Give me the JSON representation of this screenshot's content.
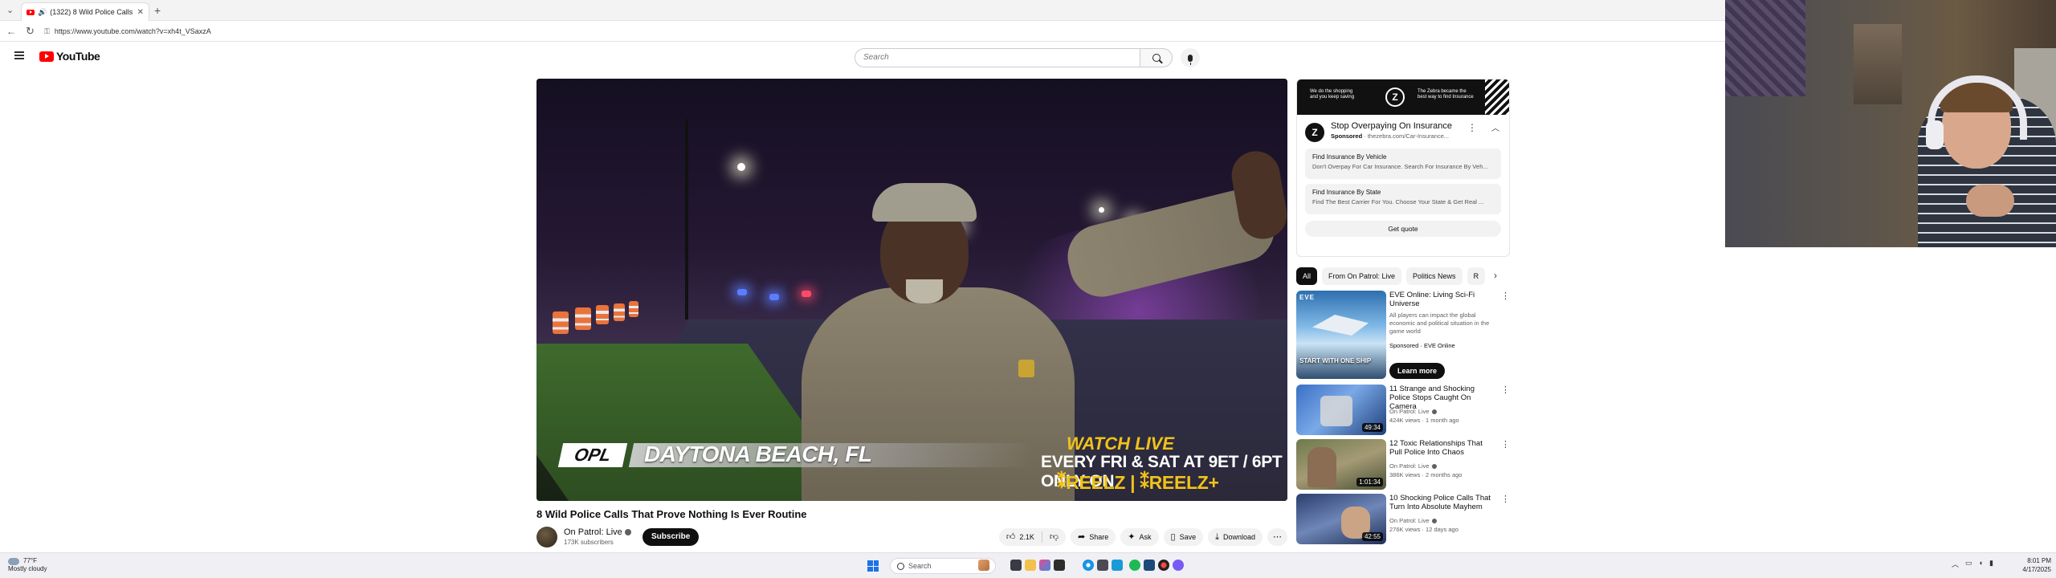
{
  "browser": {
    "tab_title": "(1322) 8 Wild Police Calls Th...",
    "url": "https://www.youtube.com/watch?v=xh4t_VSaxzA"
  },
  "youtube": {
    "logo_text": "YouTube",
    "search_placeholder": "Search"
  },
  "player": {
    "location_badge": "OPL",
    "location": "DAYTONA BEACH, FL",
    "promo_line1": "WATCH LIVE",
    "promo_line2": "EVERY FRI & SAT AT 9ET / 6PT ONLY ON",
    "promo_line3": "⁑REELZ | ⁑REELZ+"
  },
  "video": {
    "title": "8 Wild Police Calls That Prove Nothing Is Ever Routine",
    "channel": "On Patrol: Live",
    "subscribers": "173K subscribers",
    "subscribe_label": "Subscribe",
    "likes": "2.1K",
    "share_label": "Share",
    "ask_label": "Ask",
    "save_label": "Save",
    "download_label": "Download"
  },
  "ad": {
    "banner_left": "We do the shopping and you keep saving",
    "banner_right": "The Zebra became the best way to find Insurance",
    "title": "Stop Overpaying On Insurance",
    "sponsored": "Sponsored",
    "domain": "· thezebra.com/Car-Insurance...",
    "link1_title": "Find Insurance By Vehicle",
    "link1_desc": "Don't Overpay For Car Insurance. Search For Insurance By Veh...",
    "link2_title": "Find Insurance By State",
    "link2_desc": "Find The Best Carrier For You. Choose Your State & Get Real ...",
    "cta": "Get quote"
  },
  "chips": [
    "All",
    "From On Patrol: Live",
    "Politics News",
    "R"
  ],
  "recommendations": [
    {
      "title": "EVE Online: Living Sci-Fi Universe",
      "desc": "All players can impact the global economic and political situation in the game world",
      "meta1": "Sponsored · EVE Online",
      "cta": "Learn more",
      "thumb_text": "START WITH ONE SHIP",
      "thumb_brand": "EVE"
    },
    {
      "title": "11 Strange and Shocking Police Stops Caught On Camera",
      "channel": "On Patrol: Live",
      "meta": "424K views · 1 month ago",
      "duration": "49:34"
    },
    {
      "title": "12 Toxic Relationships That Pull Police Into Chaos",
      "channel": "On Patrol: Live",
      "meta": "386K views · 2 months ago",
      "duration": "1:01:34"
    },
    {
      "title": "10 Shocking Police Calls That Turn Into Absolute Mayhem",
      "channel": "On Patrol: Live",
      "meta": "276K views · 12 days ago",
      "duration": "42:55"
    }
  ],
  "taskbar": {
    "temp": "77°F",
    "weather": "Mostly cloudy",
    "search": "Search",
    "time": "8:01 PM",
    "date": "4/17/2025"
  }
}
